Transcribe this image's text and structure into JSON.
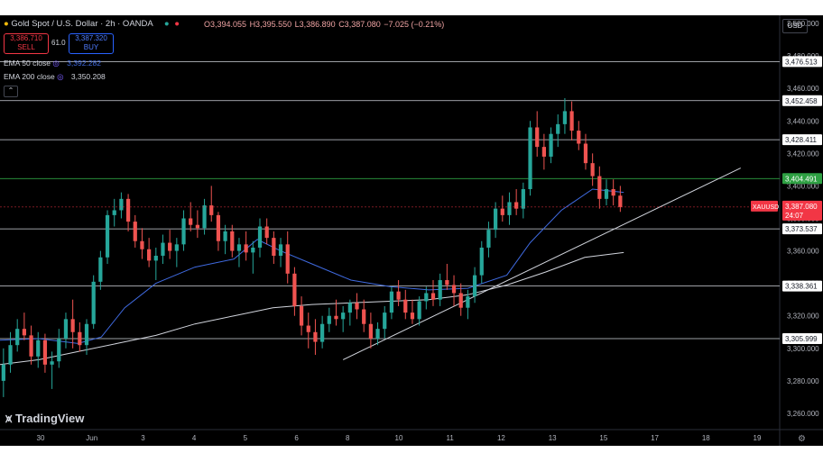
{
  "header": {
    "symbol_title": "Gold Spot / U.S. Dollar · 2h · OANDA",
    "ohlc": {
      "o": "O3,394.055",
      "h": "H3,395.550",
      "l": "L3,386.890",
      "c": "C3,387.080",
      "chg": "−7.025 (−0.21%)"
    },
    "sell_price": "3,386.710",
    "sell_label": "SELL",
    "spread": "61.0",
    "buy_price": "3,387.320",
    "buy_label": "BUY",
    "currency_button": "USD"
  },
  "indicators": [
    {
      "label": "EMA 50 close",
      "value": "3,392.282",
      "color": "#3f6ae0"
    },
    {
      "label": "EMA 200 close",
      "value": "3,350.208",
      "color": "#d1d4dc"
    }
  ],
  "branding": "TradingView",
  "price_tag": {
    "symbol": "XAUUSD",
    "price": "3,387.080",
    "countdown": "24:07",
    "color": "#f23645"
  },
  "chart_data": {
    "type": "candlestick",
    "symbol": "XAUUSD",
    "timeframe": "2h",
    "ylim": [
      3250,
      3505
    ],
    "y_ticks": [
      3260,
      3280,
      3300,
      3320,
      3340,
      3360,
      3380,
      3400,
      3420,
      3440,
      3460,
      3480,
      3500
    ],
    "x_ticks": [
      "30",
      "Jun",
      "3",
      "4",
      "5",
      "6",
      "8",
      "10",
      "11",
      "12",
      "13",
      "15",
      "17",
      "18",
      "19"
    ],
    "horizontal_levels": [
      {
        "value": 3476.513,
        "label": "3,476.513"
      },
      {
        "value": 3452.458,
        "label": "3,452.458"
      },
      {
        "value": 3428.411,
        "label": "3,428.411"
      },
      {
        "value": 3404.491,
        "label": "3,404.491",
        "color": "#2ea043"
      },
      {
        "value": 3373.537,
        "label": "3,373.537"
      },
      {
        "value": 3338.361,
        "label": "3,338.361"
      },
      {
        "value": 3305.999,
        "label": "3,305.999"
      }
    ],
    "trendline": [
      [
        0.44,
        3293
      ],
      [
        0.95,
        3411
      ]
    ],
    "ema50_path": [
      [
        0,
        3305
      ],
      [
        0.05,
        3306
      ],
      [
        0.1,
        3303
      ],
      [
        0.13,
        3307
      ],
      [
        0.16,
        3325
      ],
      [
        0.2,
        3340
      ],
      [
        0.25,
        3350
      ],
      [
        0.3,
        3355
      ],
      [
        0.33,
        3367
      ],
      [
        0.36,
        3360
      ],
      [
        0.4,
        3352
      ],
      [
        0.45,
        3342
      ],
      [
        0.5,
        3338
      ],
      [
        0.55,
        3336
      ],
      [
        0.6,
        3337
      ],
      [
        0.65,
        3345
      ],
      [
        0.68,
        3365
      ],
      [
        0.72,
        3385
      ],
      [
        0.76,
        3398
      ],
      [
        0.8,
        3396
      ]
    ],
    "ema200_path": [
      [
        0,
        3290
      ],
      [
        0.05,
        3293
      ],
      [
        0.1,
        3298
      ],
      [
        0.15,
        3303
      ],
      [
        0.2,
        3308
      ],
      [
        0.25,
        3315
      ],
      [
        0.3,
        3320
      ],
      [
        0.35,
        3325
      ],
      [
        0.4,
        3327
      ],
      [
        0.45,
        3328
      ],
      [
        0.5,
        3329
      ],
      [
        0.55,
        3330
      ],
      [
        0.6,
        3333
      ],
      [
        0.65,
        3339
      ],
      [
        0.7,
        3347
      ],
      [
        0.75,
        3356
      ],
      [
        0.8,
        3359
      ]
    ],
    "candles": [
      [
        3280,
        3300,
        3270,
        3290
      ],
      [
        3290,
        3310,
        3285,
        3302
      ],
      [
        3302,
        3318,
        3298,
        3312
      ],
      [
        3312,
        3322,
        3305,
        3308
      ],
      [
        3308,
        3314,
        3290,
        3295
      ],
      [
        3295,
        3310,
        3288,
        3305
      ],
      [
        3305,
        3309,
        3285,
        3290
      ],
      [
        3290,
        3298,
        3275,
        3292
      ],
      [
        3292,
        3312,
        3288,
        3306
      ],
      [
        3306,
        3322,
        3300,
        3318
      ],
      [
        3318,
        3330,
        3300,
        3310
      ],
      [
        3310,
        3316,
        3298,
        3302
      ],
      [
        3302,
        3318,
        3296,
        3315
      ],
      [
        3315,
        3345,
        3312,
        3341
      ],
      [
        3341,
        3360,
        3336,
        3356
      ],
      [
        3356,
        3385,
        3352,
        3382
      ],
      [
        3382,
        3392,
        3375,
        3385
      ],
      [
        3385,
        3396,
        3380,
        3392
      ],
      [
        3392,
        3395,
        3372,
        3378
      ],
      [
        3378,
        3382,
        3362,
        3366
      ],
      [
        3366,
        3374,
        3355,
        3361
      ],
      [
        3361,
        3368,
        3350,
        3354
      ],
      [
        3354,
        3362,
        3342,
        3357
      ],
      [
        3357,
        3370,
        3352,
        3365
      ],
      [
        3365,
        3373,
        3355,
        3360
      ],
      [
        3360,
        3368,
        3350,
        3364
      ],
      [
        3364,
        3385,
        3360,
        3380
      ],
      [
        3380,
        3390,
        3372,
        3376
      ],
      [
        3376,
        3385,
        3368,
        3374
      ],
      [
        3374,
        3392,
        3370,
        3388
      ],
      [
        3388,
        3400,
        3378,
        3382
      ],
      [
        3382,
        3384,
        3360,
        3366
      ],
      [
        3366,
        3376,
        3358,
        3372
      ],
      [
        3372,
        3376,
        3356,
        3360
      ],
      [
        3360,
        3368,
        3350,
        3364
      ],
      [
        3364,
        3372,
        3354,
        3359
      ],
      [
        3359,
        3366,
        3346,
        3362
      ],
      [
        3362,
        3380,
        3356,
        3375
      ],
      [
        3375,
        3380,
        3364,
        3368
      ],
      [
        3368,
        3372,
        3352,
        3357
      ],
      [
        3357,
        3368,
        3350,
        3364
      ],
      [
        3364,
        3372,
        3340,
        3346
      ],
      [
        3346,
        3350,
        3320,
        3326
      ],
      [
        3326,
        3332,
        3308,
        3314
      ],
      [
        3314,
        3322,
        3300,
        3310
      ],
      [
        3310,
        3318,
        3296,
        3304
      ],
      [
        3304,
        3320,
        3300,
        3315
      ],
      [
        3315,
        3325,
        3310,
        3320
      ],
      [
        3320,
        3330,
        3314,
        3318
      ],
      [
        3318,
        3326,
        3310,
        3322
      ],
      [
        3322,
        3330,
        3314,
        3328
      ],
      [
        3328,
        3334,
        3318,
        3324
      ],
      [
        3324,
        3330,
        3310,
        3315
      ],
      [
        3315,
        3322,
        3300,
        3306
      ],
      [
        3306,
        3316,
        3302,
        3312
      ],
      [
        3312,
        3326,
        3306,
        3322
      ],
      [
        3322,
        3338,
        3318,
        3335
      ],
      [
        3335,
        3342,
        3326,
        3330
      ],
      [
        3330,
        3336,
        3318,
        3322
      ],
      [
        3322,
        3330,
        3315,
        3318
      ],
      [
        3318,
        3332,
        3314,
        3329
      ],
      [
        3329,
        3338,
        3324,
        3334
      ],
      [
        3334,
        3342,
        3326,
        3330
      ],
      [
        3330,
        3346,
        3326,
        3342
      ],
      [
        3342,
        3352,
        3336,
        3339
      ],
      [
        3339,
        3345,
        3326,
        3334
      ],
      [
        3334,
        3340,
        3320,
        3325
      ],
      [
        3325,
        3336,
        3318,
        3332
      ],
      [
        3332,
        3350,
        3328,
        3345
      ],
      [
        3345,
        3366,
        3340,
        3362
      ],
      [
        3362,
        3378,
        3356,
        3373
      ],
      [
        3373,
        3390,
        3368,
        3386
      ],
      [
        3386,
        3394,
        3378,
        3382
      ],
      [
        3382,
        3396,
        3376,
        3390
      ],
      [
        3390,
        3398,
        3382,
        3386
      ],
      [
        3386,
        3402,
        3380,
        3398
      ],
      [
        3398,
        3440,
        3394,
        3436
      ],
      [
        3436,
        3446,
        3418,
        3424
      ],
      [
        3424,
        3432,
        3410,
        3418
      ],
      [
        3418,
        3436,
        3414,
        3432
      ],
      [
        3432,
        3444,
        3424,
        3438
      ],
      [
        3438,
        3454,
        3432,
        3446
      ],
      [
        3446,
        3452,
        3428,
        3434
      ],
      [
        3434,
        3440,
        3422,
        3426
      ],
      [
        3426,
        3432,
        3410,
        3414
      ],
      [
        3414,
        3420,
        3400,
        3406
      ],
      [
        3406,
        3412,
        3386,
        3392
      ],
      [
        3392,
        3404,
        3388,
        3398
      ],
      [
        3398,
        3404,
        3388,
        3394
      ],
      [
        3394,
        3400,
        3384,
        3387
      ]
    ]
  }
}
